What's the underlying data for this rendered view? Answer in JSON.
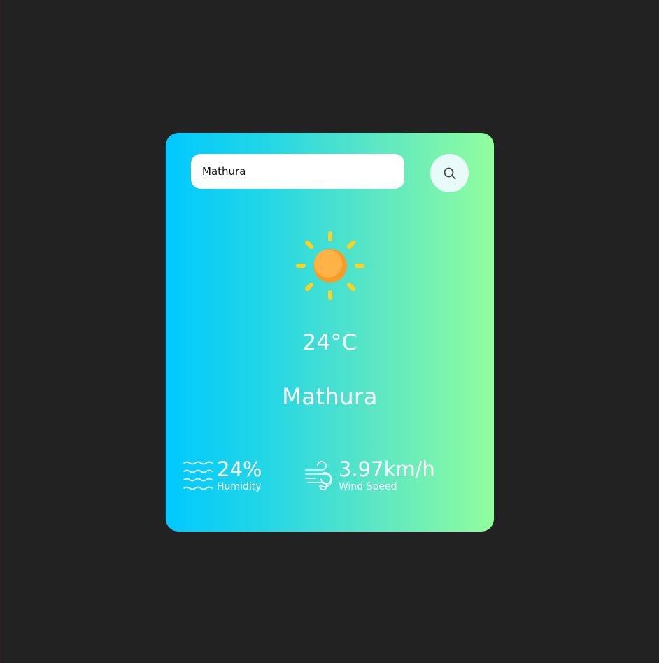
{
  "search": {
    "value": "Mathura",
    "button_icon": "search-icon"
  },
  "weather": {
    "icon": "sun-icon",
    "temperature": "24°C",
    "city": "Mathura"
  },
  "details": {
    "humidity": {
      "value": "24%",
      "label": "Humidity",
      "icon": "humidity-waves-icon"
    },
    "wind": {
      "value": "3.97km/h",
      "label": "Wind Speed",
      "icon": "wind-icon"
    }
  },
  "colors": {
    "page_background": "#222222",
    "gradient_start": "#00c9ff",
    "gradient_end": "#92fe9d",
    "sun_core": "#ffaa33",
    "sun_rays": "#ffd21f"
  }
}
